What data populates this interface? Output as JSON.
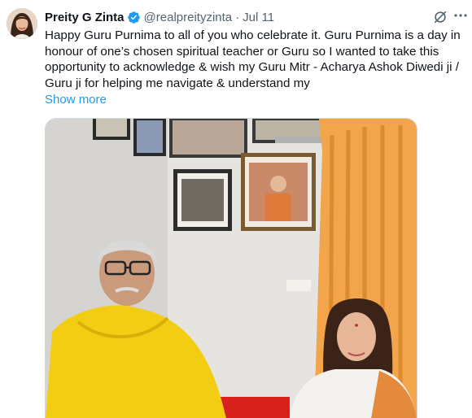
{
  "tweet": {
    "author_name": "Preity G Zinta",
    "handle": "@realpreityzinta",
    "separator": "·",
    "date": "Jul 11",
    "text": "Happy Guru Purnima to all of you who celebrate it. Guru Purnima is a day in honour of one’s chosen spiritual teacher or Guru so I wanted to take this opportunity to acknowledge & wish my Guru Mitr - Acharya Ashok Diwedi ji / Guru ji for helping me navigate & understand my",
    "show_more_label": "Show more",
    "colors": {
      "link": "#1d9bf0",
      "secondary_text": "#536471",
      "verified": "#1d9bf0"
    },
    "icons": [
      "verified-badge-icon",
      "grok-icon",
      "more-options-icon"
    ]
  }
}
